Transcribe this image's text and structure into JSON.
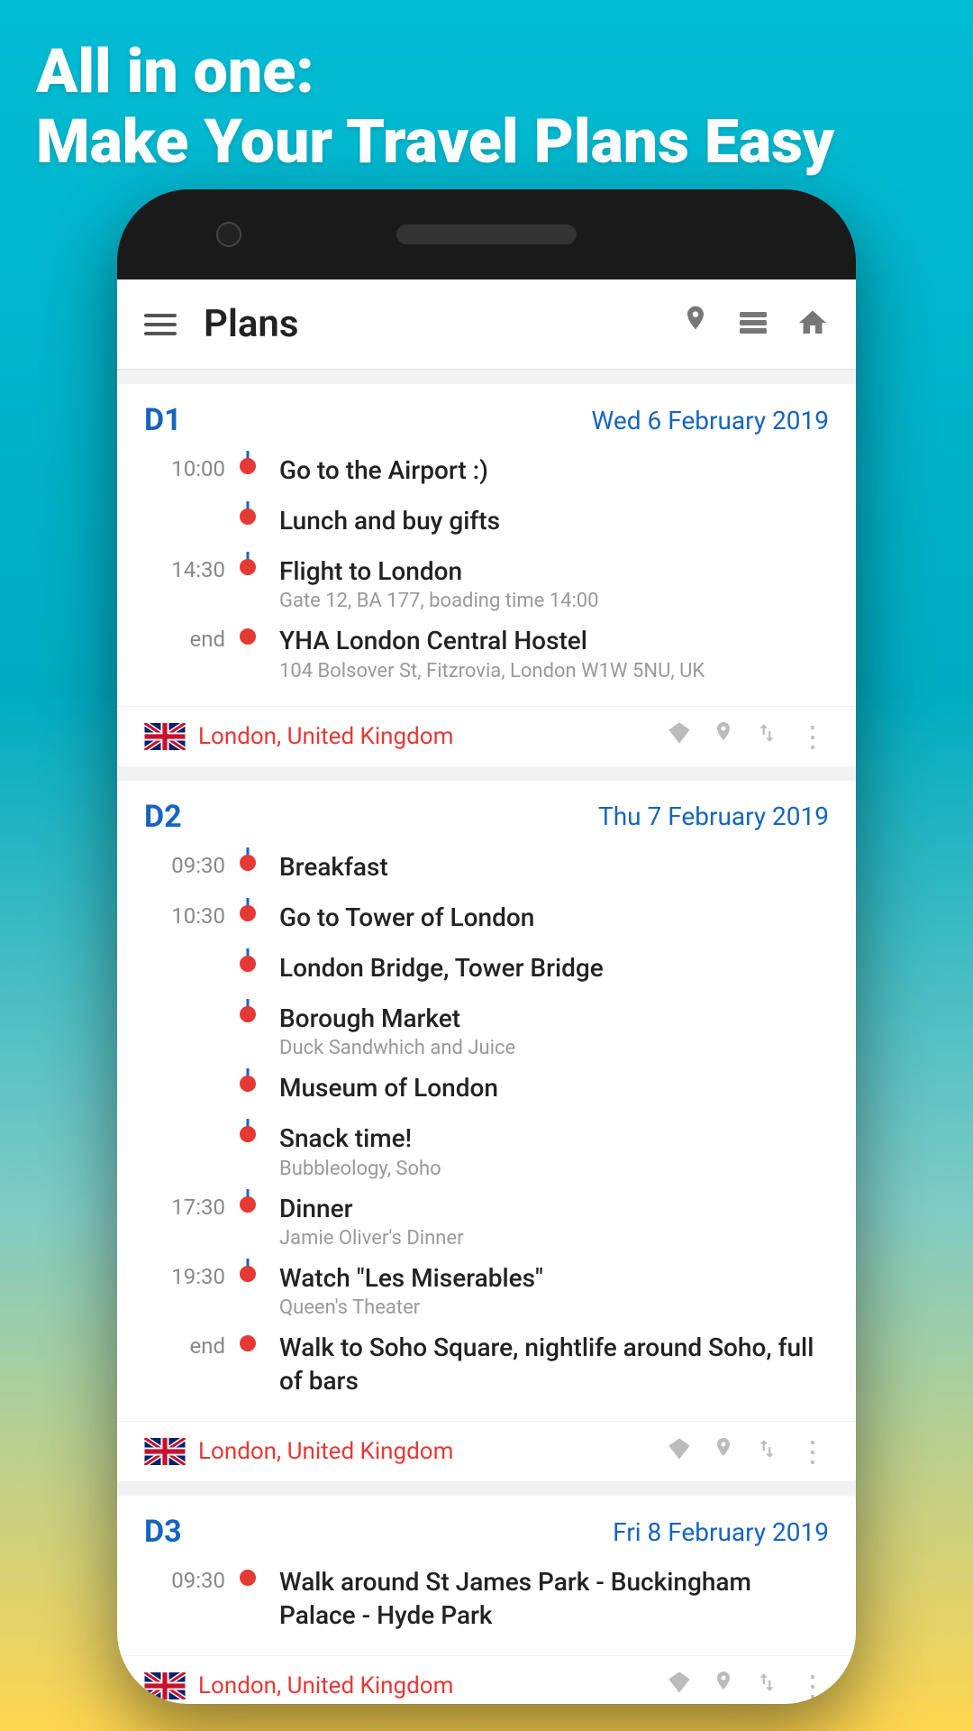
{
  "hero": {
    "title_line1": "All in one:",
    "title_line2": "Make Your Travel Plans Easy"
  },
  "app_bar": {
    "title": "Plans"
  },
  "days": [
    {
      "id": "D1",
      "label": "D1",
      "date": "Wed 6 February 2019",
      "items": [
        {
          "time": "10:00",
          "title": "Go to the Airport :)",
          "subtitle": ""
        },
        {
          "time": "",
          "title": "Lunch and buy gifts",
          "subtitle": ""
        },
        {
          "time": "14:30",
          "title": "Flight to London",
          "subtitle": "Gate 12, BA 177, boading time 14:00"
        },
        {
          "time": "end",
          "title": "YHA London Central Hostel",
          "subtitle": "104 Bolsover St, Fitzrovia, London W1W 5NU, UK"
        }
      ],
      "location": "London, United Kingdom"
    },
    {
      "id": "D2",
      "label": "D2",
      "date": "Thu 7 February 2019",
      "items": [
        {
          "time": "09:30",
          "title": "Breakfast",
          "subtitle": ""
        },
        {
          "time": "10:30",
          "title": "Go to Tower of London",
          "subtitle": ""
        },
        {
          "time": "",
          "title": "London Bridge, Tower Bridge",
          "subtitle": ""
        },
        {
          "time": "",
          "title": "Borough Market",
          "subtitle": "Duck Sandwhich and Juice"
        },
        {
          "time": "",
          "title": "Museum of London",
          "subtitle": ""
        },
        {
          "time": "",
          "title": "Snack time!",
          "subtitle": "Bubbleology, Soho"
        },
        {
          "time": "17:30",
          "title": "Dinner",
          "subtitle": "Jamie Oliver's Dinner"
        },
        {
          "time": "19:30",
          "title": "Watch \"Les Miserables\"",
          "subtitle": "Queen's Theater"
        },
        {
          "time": "end",
          "title": "Walk to Soho Square, nightlife around Soho, full of bars",
          "subtitle": ""
        }
      ],
      "location": "London, United Kingdom"
    },
    {
      "id": "D3",
      "label": "D3",
      "date": "Fri 8 February 2019",
      "items": [
        {
          "time": "09:30",
          "title": "Walk around St James Park - Buckingham Palace - Hyde Park",
          "subtitle": ""
        }
      ],
      "location": "London, United Kingdom"
    }
  ]
}
